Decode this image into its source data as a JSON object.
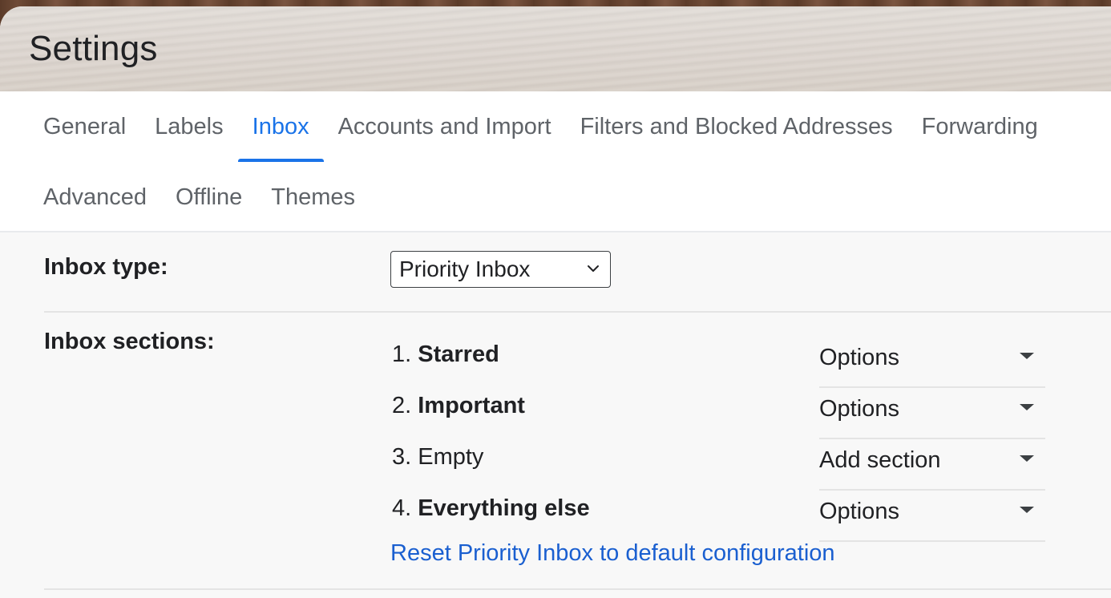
{
  "page": {
    "title": "Settings"
  },
  "tabs": {
    "row1": [
      {
        "label": "General",
        "active": false
      },
      {
        "label": "Labels",
        "active": false
      },
      {
        "label": "Inbox",
        "active": true
      },
      {
        "label": "Accounts and Import",
        "active": false
      },
      {
        "label": "Filters and Blocked Addresses",
        "active": false
      },
      {
        "label": "Forwarding",
        "active": false
      }
    ],
    "row2": [
      {
        "label": "Advanced",
        "active": false
      },
      {
        "label": "Offline",
        "active": false
      },
      {
        "label": "Themes",
        "active": false
      }
    ]
  },
  "inbox_type": {
    "label": "Inbox type:",
    "selected": "Priority Inbox"
  },
  "inbox_sections": {
    "label": "Inbox sections:",
    "items": [
      {
        "number": "1.",
        "name": "Starred",
        "bold": true,
        "action": "Options"
      },
      {
        "number": "2.",
        "name": "Important",
        "bold": true,
        "action": "Options"
      },
      {
        "number": "3.",
        "name": "Empty",
        "bold": false,
        "action": "Add section"
      },
      {
        "number": "4.",
        "name": "Everything else",
        "bold": true,
        "action": "Options"
      }
    ],
    "reset_link": "Reset Priority Inbox to default configuration"
  },
  "colors": {
    "accent": "#1a73e8",
    "link": "#1a5fd0",
    "text": "#202124",
    "muted": "#5f6368"
  }
}
